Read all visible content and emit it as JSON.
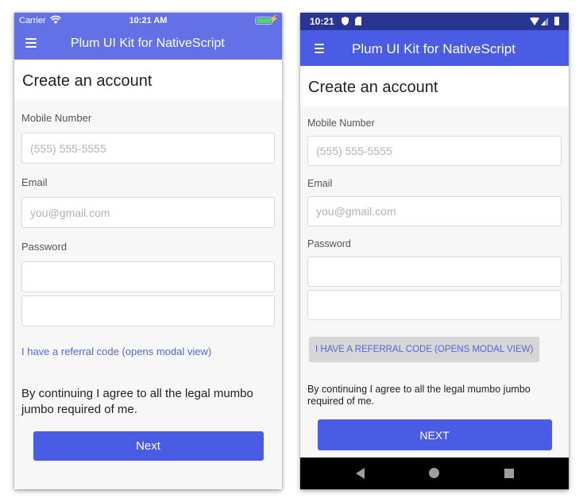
{
  "ios": {
    "status": {
      "carrier": "Carrier",
      "time": "10:21 AM",
      "wifi_icon": "wifi-icon",
      "battery_icon": "battery-charging-icon",
      "charging_glyph": "⚡"
    },
    "nav": {
      "menu_icon": "hamburger-menu-icon",
      "title": "Plum UI Kit for NativeScript"
    },
    "page_title": "Create an account",
    "form": {
      "mobile_label": "Mobile Number",
      "mobile_placeholder": "(555) 555-5555",
      "mobile_value": "",
      "email_label": "Email",
      "email_placeholder": "you@gmail.com",
      "email_value": "",
      "password_label": "Password",
      "password_value": "",
      "password_confirm_value": ""
    },
    "referral_label": "I have a referral code (opens modal view)",
    "legal_text": "By continuing I agree to all the legal mumbo jumbo required of me.",
    "next_label": "Next"
  },
  "android": {
    "status": {
      "time": "10:21",
      "shield_icon": "shield-icon",
      "sd_icon": "sd-card-icon",
      "wifi_icon": "wifi-icon",
      "signal_icon": "cell-signal-icon",
      "battery_icon": "battery-charging-icon"
    },
    "nav": {
      "menu_icon": "hamburger-menu-icon",
      "title": "Plum UI Kit for NativeScript"
    },
    "page_title": "Create an account",
    "form": {
      "mobile_label": "Mobile Number",
      "mobile_placeholder": "(555) 555-5555",
      "mobile_value": "",
      "email_label": "Email",
      "email_placeholder": "you@gmail.com",
      "email_value": "",
      "password_label": "Password",
      "password_value": "",
      "password_confirm_value": ""
    },
    "referral_label": "I HAVE A REFERRAL CODE (OPENS MODAL VIEW)",
    "legal_text": "By continuing I agree to all the legal mumbo jumbo required of me.",
    "next_label": "NEXT",
    "system_nav": [
      "back",
      "home",
      "recents"
    ]
  },
  "colors": {
    "ios_nav": "#6470e6",
    "android_status": "#283593",
    "android_nav": "#4b5ce4",
    "primary_button": "#4b5ce4",
    "link": "#5566d9",
    "page_bg": "#f7f7f7"
  }
}
